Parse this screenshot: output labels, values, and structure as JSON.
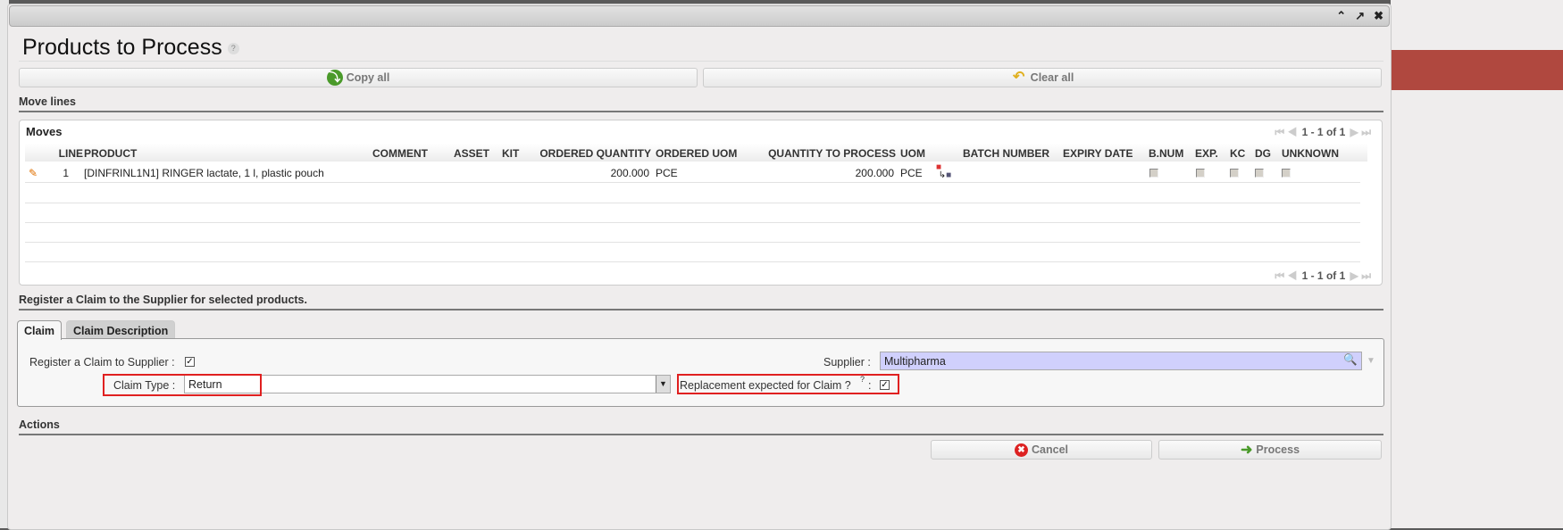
{
  "dialog": {
    "title": "Products to Process",
    "help": "?"
  },
  "toolbar": {
    "copy_all": "Copy all",
    "clear_all": "Clear all"
  },
  "sections": {
    "move_lines": "Move lines",
    "claim": "Register a Claim to the Supplier for selected products.",
    "actions": "Actions"
  },
  "moves": {
    "title": "Moves",
    "pager": "1 - 1 of 1",
    "columns": [
      "LINE",
      "PRODUCT",
      "COMMENT",
      "ASSET",
      "KIT",
      "ORDERED QUANTITY",
      "ORDERED UOM",
      "QUANTITY TO PROCESS",
      "UOM",
      "BATCH NUMBER",
      "EXPIRY DATE",
      "B.NUM",
      "EXP.",
      "KC",
      "DG",
      "UNKNOWN"
    ],
    "rows": [
      {
        "line": "1",
        "product": "[DINFRINL1N1] RINGER lactate, 1 l, plastic pouch",
        "ordered_qty": "200.000",
        "ordered_uom": "PCE",
        "qty_to_process": "200.000",
        "uom": "PCE"
      }
    ]
  },
  "tabs": [
    "Claim",
    "Claim Description"
  ],
  "claim": {
    "register_label": "Register a Claim to Supplier :",
    "register_checked": true,
    "supplier_label": "Supplier :",
    "supplier_value": "Multipharma",
    "claim_type_label": "Claim Type :",
    "claim_type_value": "Return",
    "replacement_label": "Replacement expected for Claim ?",
    "replacement_help": "?",
    "replacement_sep": ":",
    "replacement_checked": true
  },
  "actions": {
    "cancel": "Cancel",
    "process": "Process"
  }
}
